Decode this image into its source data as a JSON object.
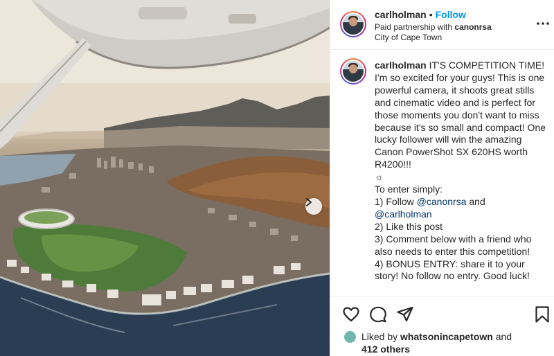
{
  "header": {
    "username": "carlholman",
    "dot": "•",
    "follow_label": "Follow",
    "partnership_prefix": "Paid partnership with",
    "partner": "canonrsa",
    "location": "City of Cape Town"
  },
  "caption": {
    "username": "carlholman",
    "text_1": "IT'S COMPETITION TIME! I'm so excited for your guys! This is one powerful camera, it shoots great stills and cinematic video and is perfect for those moments you don't want to miss because it's so small and compact! One lucky follower will win the amazing Canon PowerShot SX 620HS worth R4200!!!",
    "sparkle": "☼",
    "enter_line": "To enter simply:",
    "step1_prefix": "1) Follow",
    "mention_1": "@canonrsa",
    "and": "and",
    "mention_2": "@carlholman",
    "step2": "2) Like this post",
    "step3": "3) Comment below with a friend who also needs to enter this competition!",
    "step4": "4) BONUS ENTRY: share it to your story! No follow no entry. Good luck!"
  },
  "likes": {
    "prefix": "Liked by",
    "user": "whatsonincapetown",
    "and": "and",
    "count": "412 others"
  },
  "icons": {
    "like": "heart-icon",
    "comment": "comment-icon",
    "share": "share-icon",
    "save": "bookmark-icon",
    "more": "more-options-icon",
    "next": "chevron-right-icon"
  },
  "colors": {
    "follow": "#0095f6",
    "mention": "#00376b",
    "text": "#262626"
  }
}
